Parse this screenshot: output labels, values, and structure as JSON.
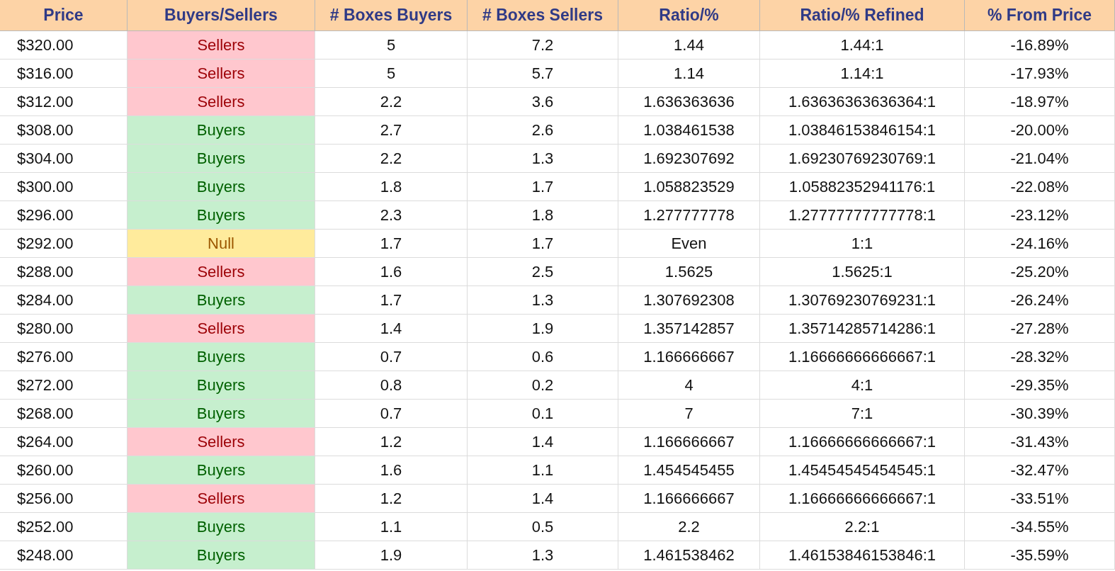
{
  "table": {
    "columns": [
      "Price",
      "Buyers/Sellers",
      "# Boxes Buyers",
      "# Boxes Sellers",
      "Ratio/%",
      "Ratio/% Refined",
      "% From Price"
    ],
    "rows": [
      {
        "price": "$320.00",
        "side": {
          "label": "Sellers",
          "kind": "sellers"
        },
        "buyers": "5",
        "sellers": "7.2",
        "ratio": "1.44",
        "refined": "1.44:1",
        "pct": "-16.89%"
      },
      {
        "price": "$316.00",
        "side": {
          "label": "Sellers",
          "kind": "sellers"
        },
        "buyers": "5",
        "sellers": "5.7",
        "ratio": "1.14",
        "refined": "1.14:1",
        "pct": "-17.93%"
      },
      {
        "price": "$312.00",
        "side": {
          "label": "Sellers",
          "kind": "sellers"
        },
        "buyers": "2.2",
        "sellers": "3.6",
        "ratio": "1.636363636",
        "refined": "1.63636363636364:1",
        "pct": "-18.97%"
      },
      {
        "price": "$308.00",
        "side": {
          "label": "Buyers",
          "kind": "buyers"
        },
        "buyers": "2.7",
        "sellers": "2.6",
        "ratio": "1.038461538",
        "refined": "1.03846153846154:1",
        "pct": "-20.00%"
      },
      {
        "price": "$304.00",
        "side": {
          "label": "Buyers",
          "kind": "buyers"
        },
        "buyers": "2.2",
        "sellers": "1.3",
        "ratio": "1.692307692",
        "refined": "1.69230769230769:1",
        "pct": "-21.04%"
      },
      {
        "price": "$300.00",
        "side": {
          "label": "Buyers",
          "kind": "buyers"
        },
        "buyers": "1.8",
        "sellers": "1.7",
        "ratio": "1.058823529",
        "refined": "1.05882352941176:1",
        "pct": "-22.08%"
      },
      {
        "price": "$296.00",
        "side": {
          "label": "Buyers",
          "kind": "buyers"
        },
        "buyers": "2.3",
        "sellers": "1.8",
        "ratio": "1.277777778",
        "refined": "1.27777777777778:1",
        "pct": "-23.12%"
      },
      {
        "price": "$292.00",
        "side": {
          "label": "Null",
          "kind": "null"
        },
        "buyers": "1.7",
        "sellers": "1.7",
        "ratio": "Even",
        "refined": "1:1",
        "pct": "-24.16%"
      },
      {
        "price": "$288.00",
        "side": {
          "label": "Sellers",
          "kind": "sellers"
        },
        "buyers": "1.6",
        "sellers": "2.5",
        "ratio": "1.5625",
        "refined": "1.5625:1",
        "pct": "-25.20%"
      },
      {
        "price": "$284.00",
        "side": {
          "label": "Buyers",
          "kind": "buyers"
        },
        "buyers": "1.7",
        "sellers": "1.3",
        "ratio": "1.307692308",
        "refined": "1.30769230769231:1",
        "pct": "-26.24%"
      },
      {
        "price": "$280.00",
        "side": {
          "label": "Sellers",
          "kind": "sellers"
        },
        "buyers": "1.4",
        "sellers": "1.9",
        "ratio": "1.357142857",
        "refined": "1.35714285714286:1",
        "pct": "-27.28%"
      },
      {
        "price": "$276.00",
        "side": {
          "label": "Buyers",
          "kind": "buyers"
        },
        "buyers": "0.7",
        "sellers": "0.6",
        "ratio": "1.166666667",
        "refined": "1.16666666666667:1",
        "pct": "-28.32%"
      },
      {
        "price": "$272.00",
        "side": {
          "label": "Buyers",
          "kind": "buyers"
        },
        "buyers": "0.8",
        "sellers": "0.2",
        "ratio": "4",
        "refined": "4:1",
        "pct": "-29.35%"
      },
      {
        "price": "$268.00",
        "side": {
          "label": "Buyers",
          "kind": "buyers"
        },
        "buyers": "0.7",
        "sellers": "0.1",
        "ratio": "7",
        "refined": "7:1",
        "pct": "-30.39%"
      },
      {
        "price": "$264.00",
        "side": {
          "label": "Sellers",
          "kind": "sellers"
        },
        "buyers": "1.2",
        "sellers": "1.4",
        "ratio": "1.166666667",
        "refined": "1.16666666666667:1",
        "pct": "-31.43%"
      },
      {
        "price": "$260.00",
        "side": {
          "label": "Buyers",
          "kind": "buyers"
        },
        "buyers": "1.6",
        "sellers": "1.1",
        "ratio": "1.454545455",
        "refined": "1.45454545454545:1",
        "pct": "-32.47%"
      },
      {
        "price": "$256.00",
        "side": {
          "label": "Sellers",
          "kind": "sellers"
        },
        "buyers": "1.2",
        "sellers": "1.4",
        "ratio": "1.166666667",
        "refined": "1.16666666666667:1",
        "pct": "-33.51%"
      },
      {
        "price": "$252.00",
        "side": {
          "label": "Buyers",
          "kind": "buyers"
        },
        "buyers": "1.1",
        "sellers": "0.5",
        "ratio": "2.2",
        "refined": "2.2:1",
        "pct": "-34.55%"
      },
      {
        "price": "$248.00",
        "side": {
          "label": "Buyers",
          "kind": "buyers"
        },
        "buyers": "1.9",
        "sellers": "1.3",
        "ratio": "1.461538462",
        "refined": "1.46153846153846:1",
        "pct": "-35.59%"
      }
    ]
  }
}
